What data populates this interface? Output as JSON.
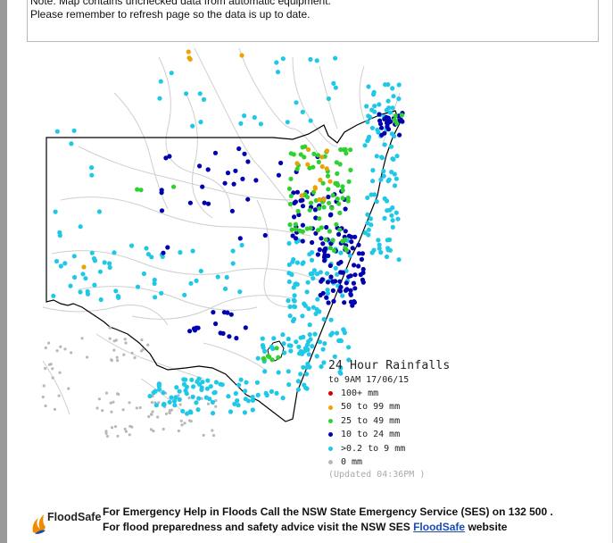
{
  "notice": {
    "line1": "Note: Map contains unchecked data from automatic equipment.",
    "line2": "Please remember to refresh page so the data is up to date."
  },
  "legend": {
    "title": "24 Hour Rainfalls",
    "subtitle": "to 9AM 17/06/15",
    "items": [
      {
        "label": "100+ mm",
        "color": "#d40000"
      },
      {
        "label": "50  to 99 mm",
        "color": "#f0a000"
      },
      {
        "label": "25  to 49 mm",
        "color": "#30d030"
      },
      {
        "label": "10  to 24 mm",
        "color": "#0000b0"
      },
      {
        "label": ">0.2 to 9 mm",
        "color": "#20c8e8"
      },
      {
        "label": "0 mm",
        "color": "#b8b8b8"
      }
    ],
    "updated": "(Updated 04:36PM  )"
  },
  "footer": {
    "logo_text": "FloodSafe",
    "line1": "For Emergency Help in Floods Call the NSW State Emergency Service (SES) on 132 500 .",
    "line2_prefix": "For flood preparedness and safety advice visit the NSW SES ",
    "line2_link": "FloodSafe",
    "line2_suffix": " website"
  },
  "colors": {
    "heavy": "#f0a000",
    "moderate": "#30d030",
    "light": "#0000b0",
    "trace": "#20c8e8",
    "none": "#b8b8b8",
    "rivers": "#c8c8c8",
    "border": "#000000"
  }
}
